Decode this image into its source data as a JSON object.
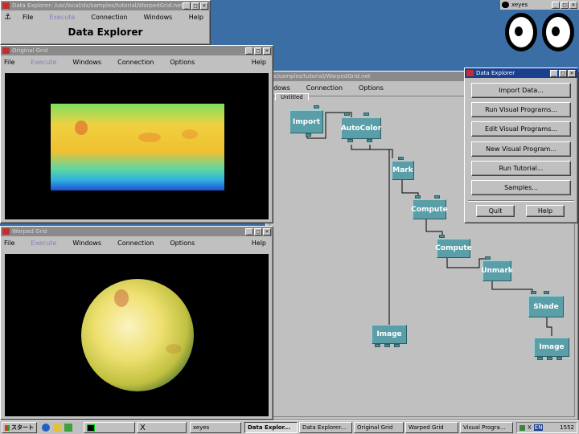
{
  "main_window": {
    "title": "Data Explorer: /usr/local/dx/samples/tutorial/WarpedGrid.net",
    "menu": [
      "File",
      "Execute",
      "Connection",
      "Windows",
      "Help"
    ],
    "heading": "Data Explorer"
  },
  "original_grid": {
    "title": "Original Grid",
    "menu": [
      "File",
      "Execute",
      "Windows",
      "Connection",
      "Options",
      "Help"
    ]
  },
  "warped_grid": {
    "title": "Warped Grid",
    "menu": [
      "File",
      "Execute",
      "Windows",
      "Connection",
      "Options",
      "Help"
    ]
  },
  "vpe": {
    "title": "/dx/samples/tutorial/WarpedGrid.net",
    "menu": [
      "ndows",
      "Connection",
      "Options"
    ],
    "page_tab": "Untitled",
    "modules": [
      "Import",
      "AutoColor",
      "Mark",
      "Compute",
      "Compute",
      "Unmark",
      "Shade",
      "Image",
      "Image"
    ]
  },
  "xeyes": {
    "title": "xeyes"
  },
  "launcher": {
    "title": "Data Explorer",
    "buttons": [
      "Import Data...",
      "Run Visual Programs...",
      "Edit Visual Programs...",
      "New Visual Program...",
      "Run Tutorial...",
      "Samples..."
    ],
    "quit": "Quit",
    "help": "Help"
  },
  "taskbar": {
    "start": "スタート",
    "items": [
      "Data Explor...",
      "Data Explorer...",
      "Original Grid",
      "Warped Grid",
      "Visual Progra..."
    ],
    "xeyes_item": "xeyes",
    "tray_lang": "EN",
    "clock": "1552"
  },
  "colors": {
    "titlebar_active": "#1b3f8f",
    "desktop": "#3a6ea5",
    "module": "#5a9ea8"
  }
}
